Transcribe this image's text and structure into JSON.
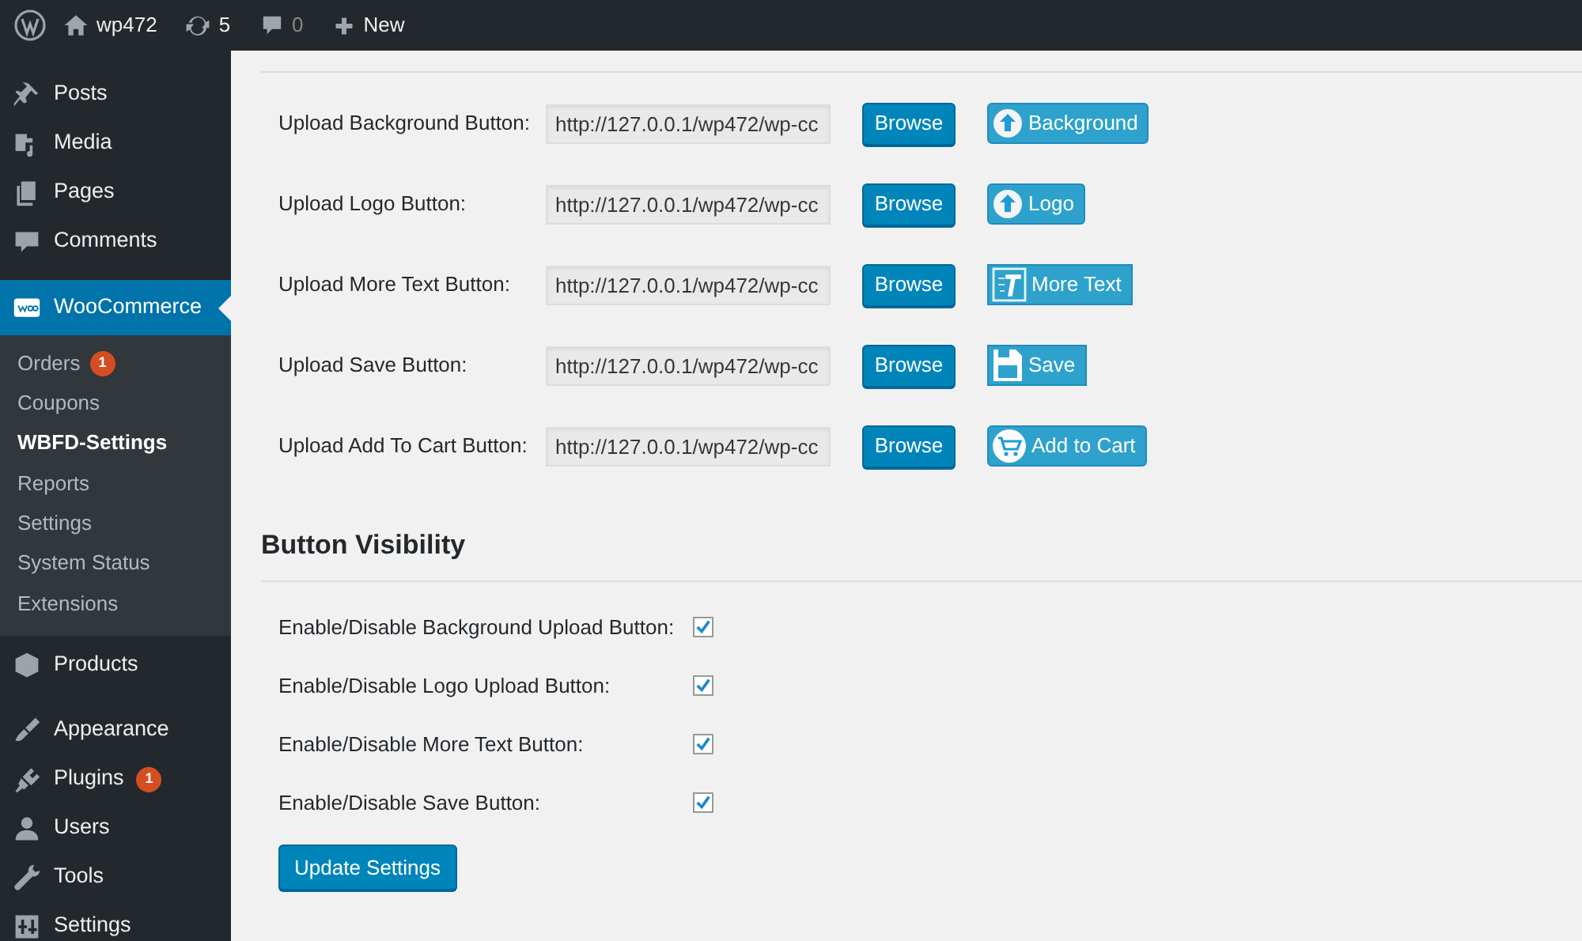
{
  "admin_bar": {
    "site": "wp472",
    "updates": "5",
    "comments": "0",
    "new": "New"
  },
  "sidebar": {
    "items": [
      {
        "label": "Posts",
        "selected": false
      },
      {
        "label": "Media",
        "selected": false
      },
      {
        "label": "Pages",
        "selected": false
      },
      {
        "label": "Comments",
        "selected": false
      },
      {
        "label": "WooCommerce",
        "selected": true,
        "children": [
          {
            "label": "Orders",
            "selected": false,
            "badge": "1"
          },
          {
            "label": "Coupons",
            "selected": false
          },
          {
            "label": "WBFD-Settings",
            "selected": true
          },
          {
            "label": "Reports",
            "selected": false
          },
          {
            "label": "Settings",
            "selected": false
          },
          {
            "label": "System Status",
            "selected": false
          },
          {
            "label": "Extensions",
            "selected": false
          }
        ]
      },
      {
        "label": "Products",
        "selected": false
      },
      {
        "label": "Appearance",
        "selected": false
      },
      {
        "label": "Plugins",
        "selected": false,
        "badge": "1"
      },
      {
        "label": "Users",
        "selected": false
      },
      {
        "label": "Tools",
        "selected": false
      },
      {
        "label": "Settings",
        "selected": false
      }
    ]
  },
  "upload_rows": [
    {
      "label": "Upload Background Button:",
      "value": "http://127.0.0.1/wp472/wp-cc",
      "button": "Browse",
      "preview": "Background",
      "kind": "upload"
    },
    {
      "label": "Upload Logo Button:",
      "value": "http://127.0.0.1/wp472/wp-cc",
      "button": "Browse",
      "preview": "Logo",
      "kind": "upload"
    },
    {
      "label": "Upload More Text Button:",
      "value": "http://127.0.0.1/wp472/wp-cc",
      "button": "Browse",
      "preview": "More Text",
      "kind": "text"
    },
    {
      "label": "Upload Save Button:",
      "value": "http://127.0.0.1/wp472/wp-cc",
      "button": "Browse",
      "preview": "Save",
      "kind": "save"
    },
    {
      "label": "Upload Add To Cart Button:",
      "value": "http://127.0.0.1/wp472/wp-cc",
      "button": "Browse",
      "preview": "Add to Cart",
      "kind": "cart"
    }
  ],
  "visibility": {
    "title": "Button Visibility",
    "options": [
      {
        "label": "Enable/Disable Background Upload Button:",
        "checked": true
      },
      {
        "label": "Enable/Disable Logo Upload Button:",
        "checked": true
      },
      {
        "label": "Enable/Disable More Text Button:",
        "checked": true
      },
      {
        "label": "Enable/Disable Save Button:",
        "checked": true
      }
    ]
  },
  "submit": "Update Settings"
}
